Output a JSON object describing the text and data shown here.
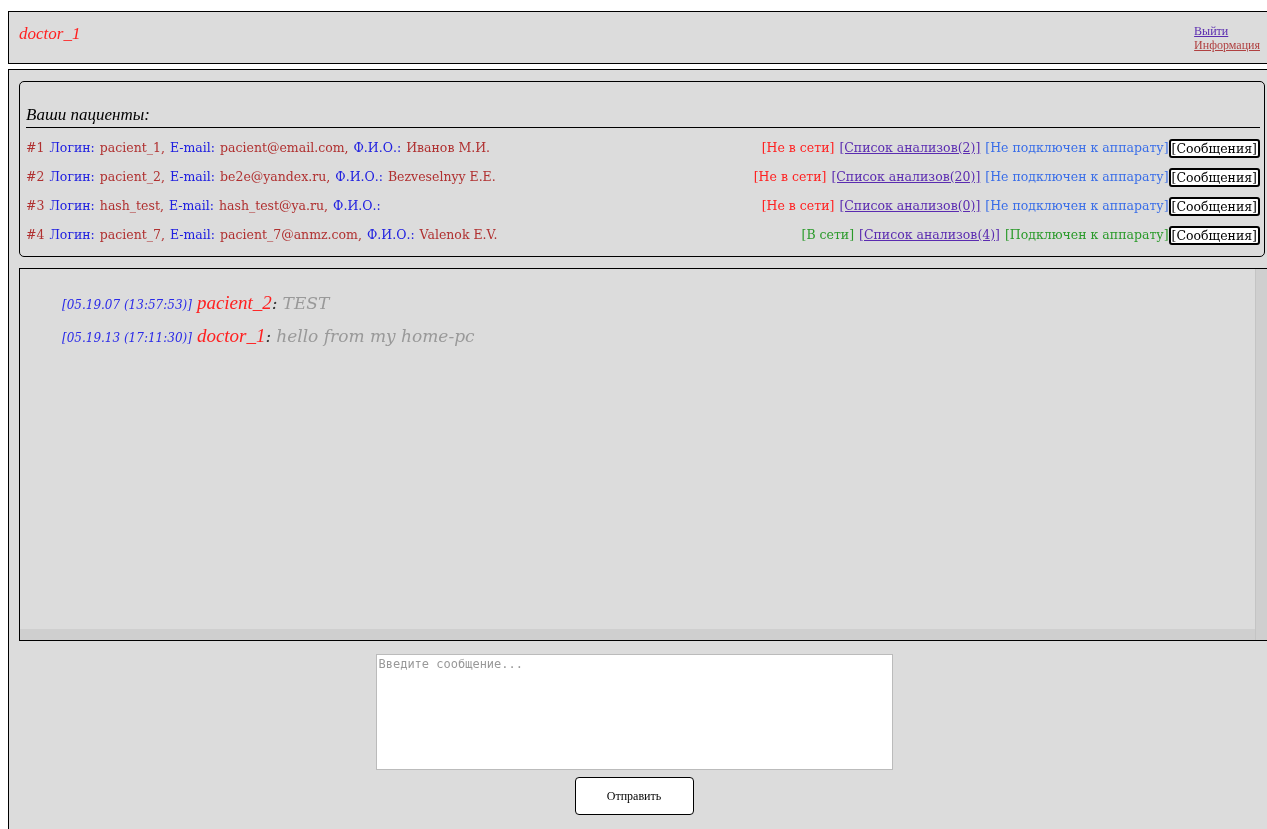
{
  "header": {
    "user": "doctor_1",
    "links": [
      "Выйти",
      "Информация"
    ]
  },
  "patients_title": "Ваши пациенты:",
  "patients": [
    {
      "number": "#1",
      "fields": [
        {
          "label": "Логин:",
          "value": "pacient_1,"
        },
        {
          "label": "E-mail:",
          "value": "pacient@email.com,"
        },
        {
          "label": "Ф.И.О.:",
          "value": "Иванов М.И."
        }
      ],
      "status": {
        "text": "[Не в сети]",
        "online": false
      },
      "analyses": "[Список анализов(2)]",
      "device": {
        "text": "[Не подключен к аппарату]",
        "connected": false
      },
      "messages_button": "[Сообщения]"
    },
    {
      "number": "#2",
      "fields": [
        {
          "label": "Логин:",
          "value": "pacient_2,"
        },
        {
          "label": "E-mail:",
          "value": "be2e@yandex.ru,"
        },
        {
          "label": "Ф.И.О.:",
          "value": "Bezveselnyy E.E."
        }
      ],
      "status": {
        "text": "[Не в сети]",
        "online": false
      },
      "analyses": "[Список анализов(20)]",
      "device": {
        "text": "[Не подключен к аппарату]",
        "connected": false
      },
      "messages_button": "[Сообщения]"
    },
    {
      "number": "#3",
      "fields": [
        {
          "label": "Логин:",
          "value": "hash_test,"
        },
        {
          "label": "E-mail:",
          "value": "hash_test@ya.ru,"
        },
        {
          "label": "Ф.И.О.:"
        }
      ],
      "status": {
        "text": "[Не в сети]",
        "online": false
      },
      "analyses": "[Список анализов(0)]",
      "device": {
        "text": "[Не подключен к аппарату]",
        "connected": false
      },
      "messages_button": "[Сообщения]"
    },
    {
      "number": "#4",
      "fields": [
        {
          "label": "Логин:",
          "value": "pacient_7,"
        },
        {
          "label": "E-mail:",
          "value": "pacient_7@anmz.com,"
        },
        {
          "label": "Ф.И.О.:",
          "value": "Valenok E.V."
        }
      ],
      "status": {
        "text": "[В сети]",
        "online": true
      },
      "analyses": "[Список анализов(4)]",
      "device": {
        "text": "[Подключен к аппарату]",
        "connected": true
      },
      "messages_button": "[Сообщения]"
    }
  ],
  "chat": [
    {
      "time": "[05.19.07 (13:57:53)]",
      "author": "pacient_2",
      "separator": ":",
      "text": "TEST"
    },
    {
      "time": "[05.19.13 (17:11:30)]",
      "author": "doctor_1",
      "separator": ":",
      "text": "hello from my home-pc"
    }
  ],
  "composer": {
    "placeholder": "Введите сообщение...",
    "button": "Отправить"
  }
}
